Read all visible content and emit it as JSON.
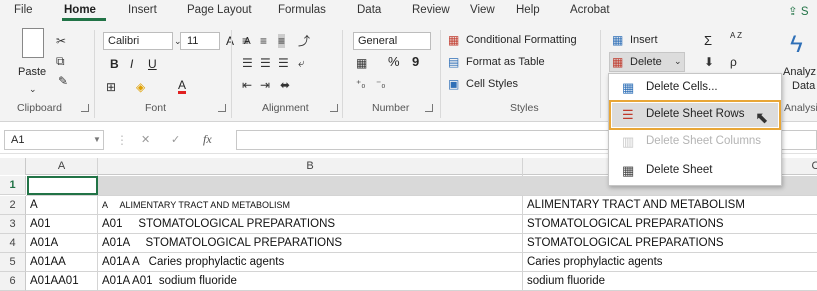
{
  "menu": [
    "File",
    "Home",
    "Insert",
    "Page Layout",
    "Formulas",
    "Data",
    "Review",
    "View",
    "Help",
    "Acrobat"
  ],
  "share_label": "S",
  "clipboard": {
    "paste": "Paste",
    "group": "Clipboard"
  },
  "font": {
    "name": "Calibri",
    "size": "11",
    "bold": "B",
    "italic": "I",
    "underline": "U",
    "grow": "A",
    "shrink": "A",
    "font_color": "A",
    "group": "Font"
  },
  "alignment": {
    "group": "Alignment"
  },
  "number": {
    "format": "General",
    "percent": "%",
    "comma": "9",
    "group": "Number"
  },
  "styles": {
    "conditional": "Conditional Formatting",
    "format_table": "Format as Table",
    "cell_styles": "Cell Styles",
    "group": "Styles"
  },
  "cells": {
    "insert": "Insert",
    "delete": "Delete"
  },
  "editing": {
    "sum": "Σ",
    "sort": "A Z",
    "find": "ρ"
  },
  "analyze": {
    "line1": "Analyz",
    "line2": "Data",
    "group": "Analysi"
  },
  "formula_bar": {
    "name_box": "A1",
    "fx": "fx",
    "cancel": "✕",
    "enter": "✓",
    "value": ""
  },
  "columns": [
    "A",
    "B",
    "C"
  ],
  "rows": [
    {
      "num": "1",
      "a": "",
      "b": "",
      "c": ""
    },
    {
      "num": "2",
      "a": "A",
      "b": "A     ALIMENTARY TRACT AND METABOLISM",
      "c": "ALIMENTARY TRACT AND METABOLISM"
    },
    {
      "num": "3",
      "a": "A01",
      "b": "A01     STOMATOLOGICAL PREPARATIONS",
      "c": "STOMATOLOGICAL PREPARATIONS"
    },
    {
      "num": "4",
      "a": "A01A",
      "b": "A01A     STOMATOLOGICAL PREPARATIONS",
      "c": "STOMATOLOGICAL PREPARATIONS"
    },
    {
      "num": "5",
      "a": "A01AA",
      "b": "A01A A   Caries prophylactic agents",
      "c": "Caries prophylactic agents"
    },
    {
      "num": "6",
      "a": "A01AA01",
      "b": "A01A A01  sodium fluoride",
      "c": "sodium fluoride"
    }
  ],
  "dropdown": {
    "delete_cells": "Delete Cells...",
    "delete_rows": "Delete Sheet Rows",
    "delete_columns": "Delete Sheet Columns",
    "delete_sheet": "Delete Sheet"
  },
  "colors": {
    "accent": "#217346",
    "highlight": "#e8a636"
  }
}
